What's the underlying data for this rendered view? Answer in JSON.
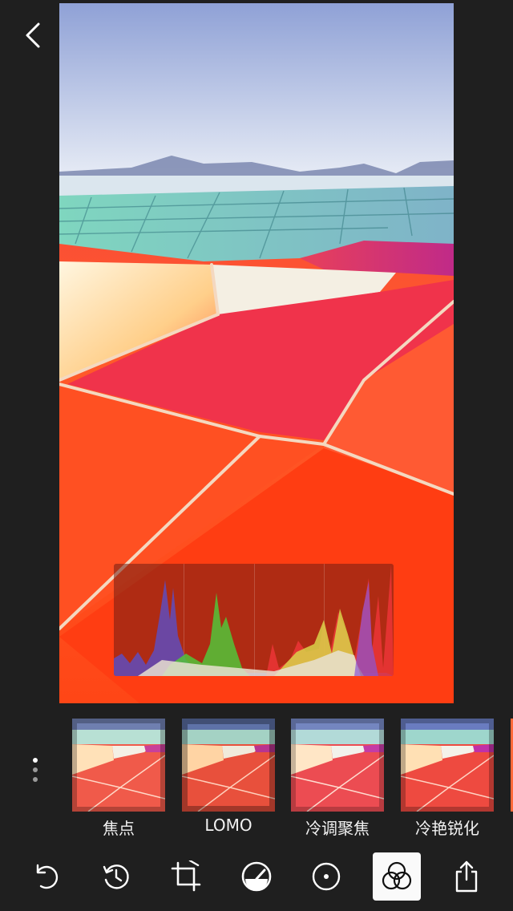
{
  "header": {
    "back_icon": "chevron-left-icon"
  },
  "photo": {
    "description_icon": "photo-preview"
  },
  "histogram": {
    "visible": true,
    "channels": [
      "blue",
      "green",
      "red",
      "luminance"
    ]
  },
  "filters": {
    "more_icon": "vertical-dots-icon",
    "items": [
      {
        "label": "焦点"
      },
      {
        "label": "LOMO"
      },
      {
        "label": "冷调聚焦"
      },
      {
        "label": "冷艳锐化"
      }
    ]
  },
  "toolbar": {
    "tools": [
      {
        "icon": "undo-icon"
      },
      {
        "icon": "history-icon"
      },
      {
        "icon": "crop-icon"
      },
      {
        "icon": "adjust-dial-icon"
      },
      {
        "icon": "focus-circle-icon"
      },
      {
        "icon": "filters-icon",
        "selected": true
      },
      {
        "icon": "share-icon"
      }
    ]
  },
  "colors": {
    "background": "#1f1f1f",
    "active_tool_bg": "#fafafa",
    "photo_red": "#ff4a1c"
  }
}
